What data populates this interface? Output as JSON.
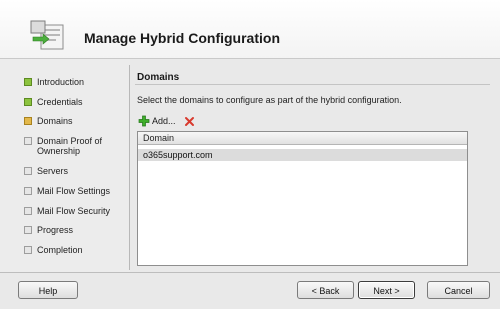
{
  "header": {
    "title": "Manage Hybrid Configuration"
  },
  "steps": [
    {
      "label": "Introduction",
      "state": "done"
    },
    {
      "label": "Credentials",
      "state": "done"
    },
    {
      "label": "Domains",
      "state": "current"
    },
    {
      "label": "Domain Proof of Ownership",
      "state": "pending"
    },
    {
      "label": "Servers",
      "state": "pending"
    },
    {
      "label": "Mail Flow Settings",
      "state": "pending"
    },
    {
      "label": "Mail Flow Security",
      "state": "pending"
    },
    {
      "label": "Progress",
      "state": "pending"
    },
    {
      "label": "Completion",
      "state": "pending"
    }
  ],
  "main": {
    "section_title": "Domains",
    "instruction": "Select the domains to configure as part of the hybrid configuration.",
    "add_label": "Add...",
    "add_icon": "green-plus-icon",
    "remove_icon": "red-x-icon",
    "list": {
      "column_header": "Domain",
      "rows": [
        "o365support.com"
      ]
    }
  },
  "buttons": {
    "help": "Help",
    "back": "< Back",
    "next": "Next >",
    "cancel": "Cancel"
  },
  "colors": {
    "done": "#8cc33f",
    "current": "#e3b84a",
    "pending": "#e6e6e6"
  }
}
